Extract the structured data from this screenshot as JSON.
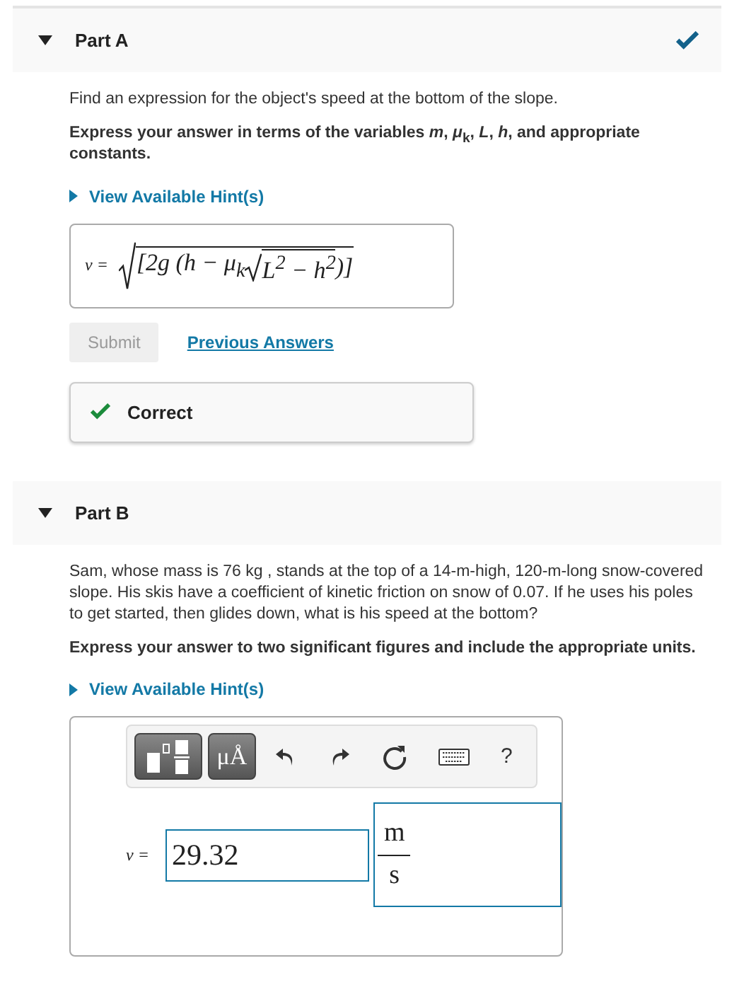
{
  "parts": [
    {
      "title": "Part A",
      "expanded": true,
      "completed": true,
      "prompt": "Find an expression for the object's speed at the bottom of the slope.",
      "instruction": "Express your answer in terms of the variables *m*, *μ*$_{k}$, *L*, *h*, and appropriate constants.",
      "hint_link": "View Available Hint(s)",
      "answer": {
        "kind": "expression",
        "variable": "v =",
        "radicand_prefix": "[2g (h − μ$_{k}$",
        "inner_radicand": "L$^{2}$ − h$^{2}$",
        "radicand_suffix": ")]"
      },
      "submit": {
        "label": "Submit",
        "disabled": true
      },
      "previous_answers": "Previous Answers",
      "feedback": "Correct"
    },
    {
      "title": "Part B",
      "expanded": true,
      "completed": false,
      "prompt": "Sam, whose mass is 76 kg , stands at the top of a 14-m-high, 120-m-long snow-covered slope. His skis have a coefficient of kinetic friction on snow of 0.07. If he uses his poles to get started, then glides down, what is his speed at the bottom?",
      "instruction": "Express your answer to two significant figures and include the appropriate units.",
      "hint_link": "View Available Hint(s)",
      "answer": {
        "kind": "value_units",
        "toolbar": {
          "units_button": "μÅ",
          "help": "?"
        },
        "variable": "v =",
        "value": "29.32",
        "unit_numerator": "m",
        "unit_denominator": "s"
      }
    }
  ]
}
